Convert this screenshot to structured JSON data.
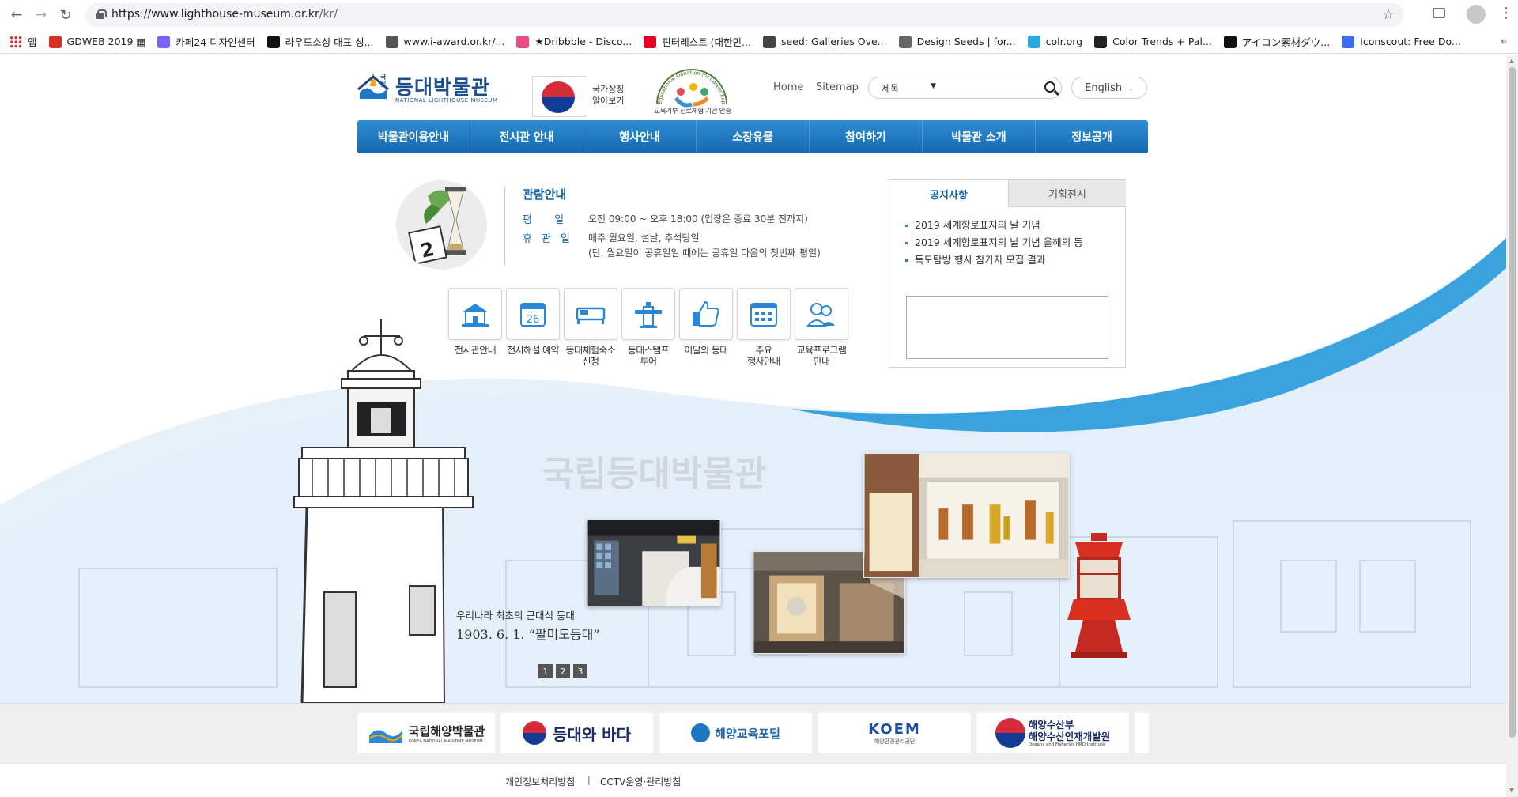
{
  "browser": {
    "url_main": "https://www.lighthouse-museum.or.kr",
    "url_path": "/kr/",
    "bookmarks": [
      {
        "label": "앱",
        "color": "#d93025"
      },
      {
        "label": "GDWEB 2019 ▦",
        "color": "#d93025"
      },
      {
        "label": "카페24 디자인센터",
        "color": "#7b61ff"
      },
      {
        "label": "라우드소싱 대표 성...",
        "color": "#111111"
      },
      {
        "label": "www.i-award.or.kr/...",
        "color": "#555555"
      },
      {
        "label": "★Dribbble - Disco...",
        "color": "#ea4c89"
      },
      {
        "label": "핀터레스트 (대한민...",
        "color": "#e60023"
      },
      {
        "label": "seed; Galleries Ove...",
        "color": "#444444"
      },
      {
        "label": "Design Seeds | for...",
        "color": "#666666"
      },
      {
        "label": "colr.org",
        "color": "#2aa8e0"
      },
      {
        "label": "Color Trends + Pal...",
        "color": "#222222"
      },
      {
        "label": "アイコン素材ダウ...",
        "color": "#111111"
      },
      {
        "label": "Iconscout: Free Do...",
        "color": "#3a6df0"
      }
    ],
    "more": "»"
  },
  "header": {
    "logo_prefix": "국립",
    "logo_kr": "등대박물관",
    "logo_en": "NATIONAL LIGHTHOUSE MUSEUM",
    "flag_text": "국가상징\n알아보기",
    "edu_arc_text": "Educational Donation for Career Experience",
    "edu_label": "교육기부 진로체험 기관 인증",
    "home": "Home",
    "sitemap": "Sitemap",
    "search_select": "제목",
    "search_placeholder": "",
    "language": "English"
  },
  "gnb": [
    "박물관이용안내",
    "전시관 안내",
    "행사안내",
    "소장유물",
    "참여하기",
    "박물관 소개",
    "정보공개"
  ],
  "visit_info": {
    "title": "관람안내",
    "weekday_label": "평 일",
    "weekday_value": "오전 09:00 ~ 오후 18:00 (입장은 종료 30분 전까지)",
    "closed_label": "휴관일",
    "closed_value": "매주 월요일, 설날, 추석당일",
    "closed_note": "(단, 월요일이 공휴일일 때에는 공휴일 다음의 첫번째 평일)",
    "calendar_number": "2"
  },
  "quick_menu": [
    {
      "label": "전시관안내",
      "icon": "museum-building-icon"
    },
    {
      "label": "전시해설 예약",
      "icon": "calendar-26-icon",
      "number": "26"
    },
    {
      "label": "등대체험숙소\n신청",
      "icon": "bed-icon"
    },
    {
      "label": "등대스탬프\n투어",
      "icon": "lighthouse-icon"
    },
    {
      "label": "이달의 등대",
      "icon": "thumbs-up-icon"
    },
    {
      "label": "주요\n행사안내",
      "icon": "schedule-calendar-icon"
    },
    {
      "label": "교육프로그램\n안내",
      "icon": "people-icon"
    }
  ],
  "notice": {
    "tab_active": "공지사항",
    "tab_inactive": "기획전시",
    "items": [
      "2019 세계항로표지의 날 기념",
      "2019 세계항로표지의 날 기념 올해의 등",
      "독도탐방 행사 참가자 모집 결과"
    ]
  },
  "visual": {
    "watermark": "국립등대박물관",
    "slogan1": "우리나라 최초의 근대식 등대",
    "slogan2": "1903. 6. 1. “팔미도등대”",
    "pages": [
      "1",
      "2",
      "3"
    ]
  },
  "family_sites": [
    {
      "label": "국립해양박물관",
      "sub": "KOREA NATIONAL MARITIME MUSEUM"
    },
    {
      "label": "등대와 바다",
      "sub": ""
    },
    {
      "label": "해양교육포털",
      "sub": ""
    },
    {
      "label": "KOEM",
      "sub": "해양환경관리공단"
    },
    {
      "label": "해양수산부\n해양수산인재개발원",
      "sub": "Oceans and Fisheries HRD Institute"
    }
  ],
  "footer": {
    "privacy": "개인정보처리방침",
    "separator": "|",
    "cctv": "CCTV운영·관리방침"
  },
  "colors": {
    "brand_blue": "#1a64a8",
    "gnb_blue": "#1f78c1",
    "wave_blue": "#3aa2dd"
  }
}
